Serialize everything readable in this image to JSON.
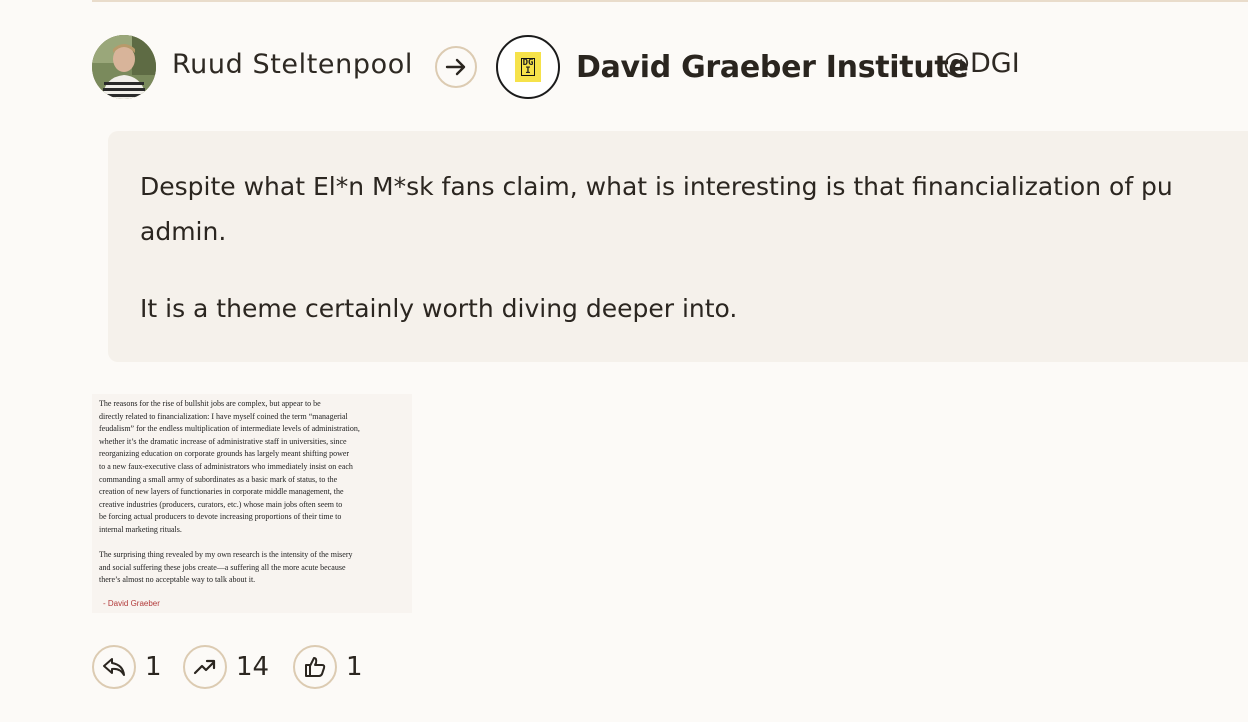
{
  "post": {
    "author_name": "Ruud Steltenpool",
    "org_name": "David Graeber Institute",
    "org_handle": "@DGI",
    "org_logo_text": "DG I"
  },
  "quote": {
    "line1": "Despite what El*n M*sk fans claim, what is interesting is that financialization of pu",
    "line2": "admin.",
    "line3": "It is a theme certainly worth diving deeper into."
  },
  "attachment": {
    "paragraph1_lines": [
      "The reasons for the rise of bullshit jobs are complex, but appear to be",
      "directly related to financialization: I have myself coined the term “managerial",
      "feudalism” for the endless multiplication of intermediate levels of administration,",
      "whether it’s the dramatic increase of administrative staff in universities, since",
      "reorganizing education on corporate grounds has largely meant shifting power",
      "to a new faux-executive class of administrators who immediately insist on each",
      "commanding a small army of subordinates as a basic mark of status, to the",
      "creation of new layers of functionaries in corporate middle management, the",
      "creative industries (producers, curators, etc.) whose main jobs often seem to",
      "be forcing actual producers to devote increasing proportions of their time to",
      "internal marketing rituals."
    ],
    "paragraph2_lines": [
      "The surprising thing revealed by my own research is the intensity of the misery",
      "and social suffering these jobs create—a suffering all the more acute because",
      "there’s almost no acceptable way to talk about it."
    ],
    "signature": "- David Graeber"
  },
  "actions": {
    "reply_count": "1",
    "boost_count": "14",
    "like_count": "1"
  },
  "colors": {
    "background": "#fcfaf7",
    "quote_bg": "#f5f1eb",
    "icon_border": "#dccbb2",
    "logo_yellow": "#f6e24a"
  }
}
